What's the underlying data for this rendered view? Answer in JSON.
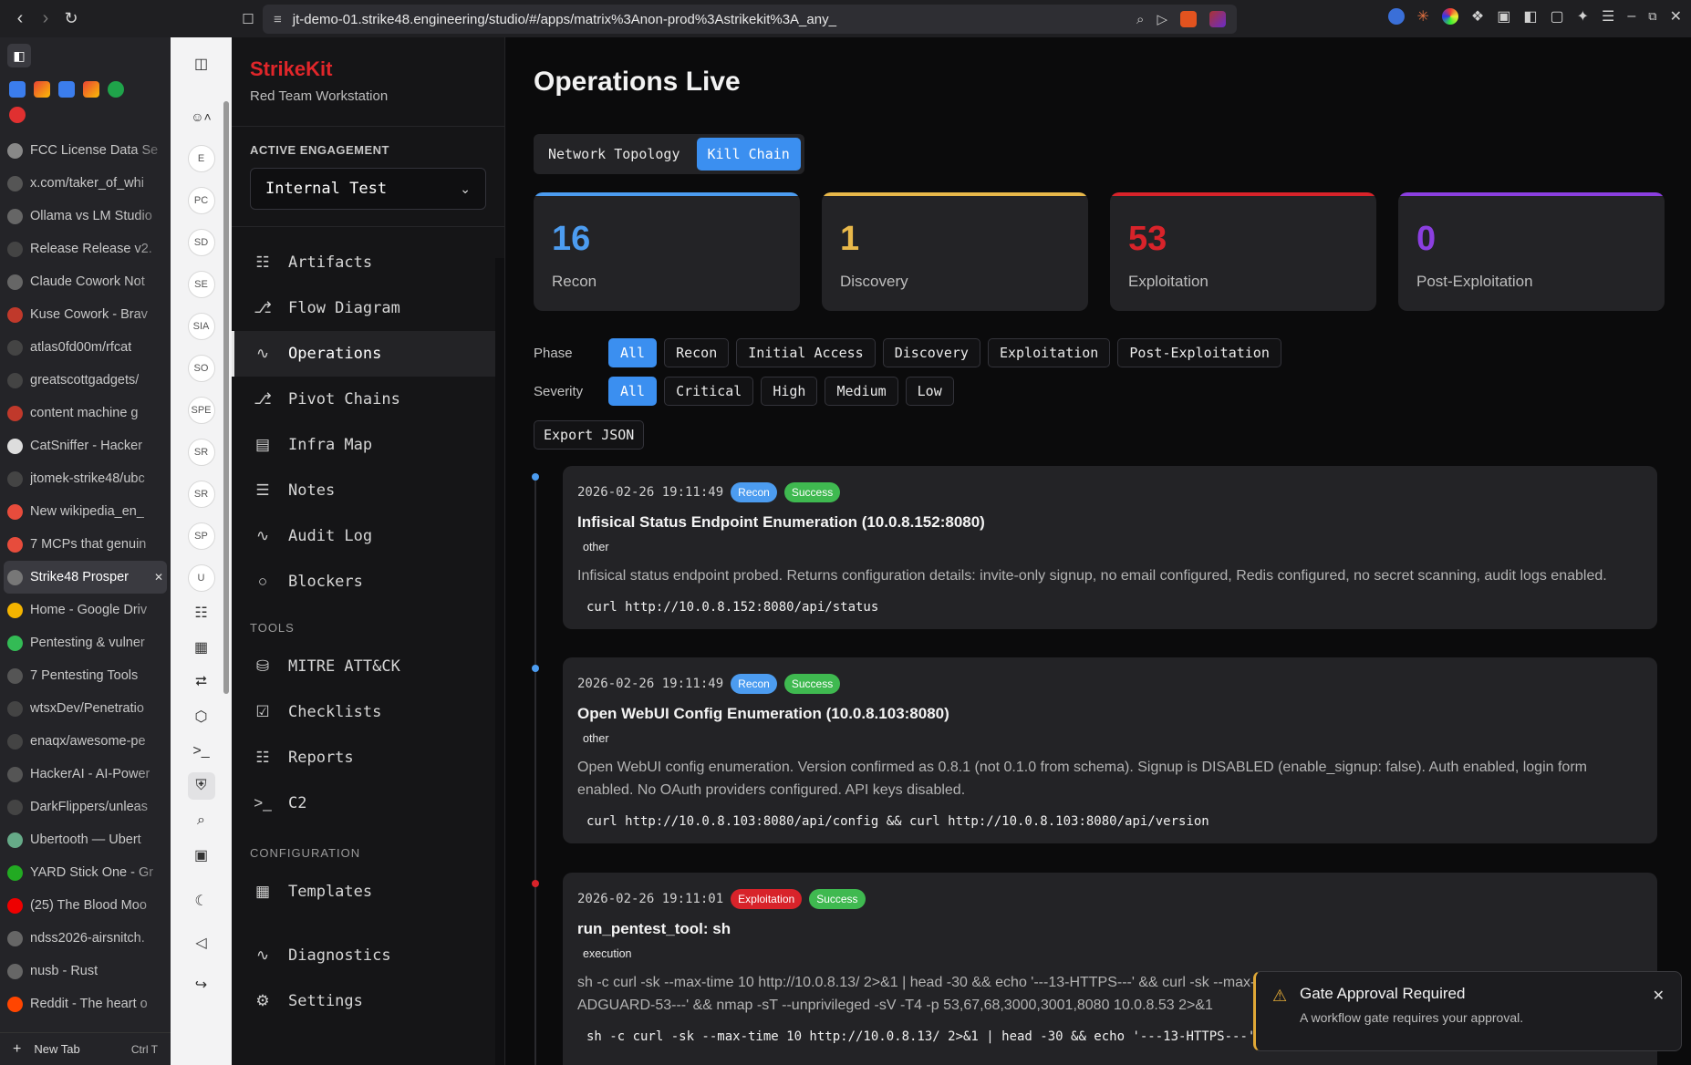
{
  "browser": {
    "url": "jt-demo-01.strike48.engineering/studio/#/apps/matrix%3Anon-prod%3Astrikekit%3A_any_",
    "tabs": [
      {
        "label": "FCC License Data Se",
        "color": "#888"
      },
      {
        "label": "x.com/taker_of_whi",
        "color": "#555"
      },
      {
        "label": "Ollama vs LM Studio",
        "color": "#666"
      },
      {
        "label": "Release Release v2.",
        "color": "#444"
      },
      {
        "label": "Claude Cowork Not",
        "color": "#666"
      },
      {
        "label": "Kuse Cowork - Brav",
        "color": "#c0392b"
      },
      {
        "label": "atlas0fd00m/rfcat",
        "color": "#444"
      },
      {
        "label": "greatscottgadgets/",
        "color": "#444"
      },
      {
        "label": "content machine g",
        "color": "#c0392b"
      },
      {
        "label": "CatSniffer - Hacker",
        "color": "#ddd"
      },
      {
        "label": "jtomek-strike48/ubc",
        "color": "#444"
      },
      {
        "label": "New wikipedia_en_",
        "color": "#e74c3c"
      },
      {
        "label": "7 MCPs that genuin",
        "color": "#e74c3c"
      },
      {
        "label": "Strike48 Prosper",
        "color": "#777",
        "active": true
      },
      {
        "label": "Home - Google Driv",
        "color": "#f4b400"
      },
      {
        "label": "Pentesting & vulner",
        "color": "#3b5"
      },
      {
        "label": "7 Pentesting Tools",
        "color": "#555"
      },
      {
        "label": "wtsxDev/Penetratio",
        "color": "#444"
      },
      {
        "label": "enaqx/awesome-pe",
        "color": "#444"
      },
      {
        "label": "HackerAI - AI-Power",
        "color": "#555"
      },
      {
        "label": "DarkFlippers/unleas",
        "color": "#444"
      },
      {
        "label": "Ubertooth — Ubert",
        "color": "#6a8"
      },
      {
        "label": "YARD Stick One - Gr",
        "color": "#2a2"
      },
      {
        "label": "(25) The Blood Moo",
        "color": "#e00"
      },
      {
        "label": "ndss2026-airsnitch.",
        "color": "#666"
      },
      {
        "label": "nusb - Rust",
        "color": "#666"
      },
      {
        "label": "Reddit - The heart o",
        "color": "#ff4500"
      }
    ],
    "new_tab": "New Tab",
    "new_tab_shortcut": "Ctrl T"
  },
  "rail": {
    "items": [
      "E",
      "PC",
      "SD",
      "SE",
      "SIA",
      "SO",
      "SPE",
      "SR",
      "SR",
      "SP",
      "U"
    ]
  },
  "app": {
    "brand": "StrikeKit",
    "subtitle": "Red Team Workstation",
    "engagement_label": "ACTIVE ENGAGEMENT",
    "engagement_value": "Internal Test",
    "nav": [
      {
        "label": "Artifacts",
        "icon": "file-icon"
      },
      {
        "label": "Flow Diagram",
        "icon": "git-branch-icon"
      },
      {
        "label": "Operations",
        "icon": "activity-icon",
        "active": true
      },
      {
        "label": "Pivot Chains",
        "icon": "git-branch-icon"
      },
      {
        "label": "Infra Map",
        "icon": "map-icon"
      },
      {
        "label": "Notes",
        "icon": "notes-icon"
      },
      {
        "label": "Audit Log",
        "icon": "activity-icon"
      },
      {
        "label": "Blockers",
        "icon": "circle-icon"
      }
    ],
    "tools_label": "TOOLS",
    "tools": [
      {
        "label": "MITRE ATT&CK",
        "icon": "database-icon"
      },
      {
        "label": "Checklists",
        "icon": "checklist-icon"
      },
      {
        "label": "Reports",
        "icon": "file-icon"
      },
      {
        "label": "C2",
        "icon": "terminal-icon"
      }
    ],
    "config_label": "CONFIGURATION",
    "config": [
      {
        "label": "Templates",
        "icon": "grid-icon"
      }
    ],
    "bottom": [
      {
        "label": "Diagnostics",
        "icon": "activity-icon"
      },
      {
        "label": "Settings",
        "icon": "gear-icon"
      }
    ]
  },
  "main": {
    "title": "Operations Live",
    "view_tabs": [
      "Network Topology",
      "Kill Chain"
    ],
    "active_view": "Kill Chain",
    "stats": [
      {
        "value": "16",
        "label": "Recon",
        "color": "#4c9cf0"
      },
      {
        "value": "1",
        "label": "Discovery",
        "color": "#e8b84a"
      },
      {
        "value": "53",
        "label": "Exploitation",
        "color": "#d8232a"
      },
      {
        "value": "0",
        "label": "Post-Exploitation",
        "color": "#8b3fe0"
      }
    ],
    "phase_label": "Phase",
    "phase_options": [
      "All",
      "Recon",
      "Initial Access",
      "Discovery",
      "Exploitation",
      "Post-Exploitation"
    ],
    "severity_label": "Severity",
    "severity_options": [
      "All",
      "Critical",
      "High",
      "Medium",
      "Low"
    ],
    "export_label": "Export JSON",
    "events": [
      {
        "time": "2026-02-26 19:11:49",
        "phase": "Recon",
        "status": "Success",
        "title": "Infisical Status Endpoint Enumeration (10.0.8.152:8080)",
        "tag": "other",
        "description": "Infisical status endpoint probed. Returns configuration details: invite-only signup, no email configured, Redis configured, no secret scanning, audit logs enabled.",
        "command": "curl http://10.0.8.152:8080/api/status"
      },
      {
        "time": "2026-02-26 19:11:49",
        "phase": "Recon",
        "status": "Success",
        "title": "Open WebUI Config Enumeration (10.0.8.103:8080)",
        "tag": "other",
        "description": "Open WebUI config enumeration. Version confirmed as 0.8.1 (not 0.1.0 from schema). Signup is DISABLED (enable_signup: false). Auth enabled, login form enabled. No OAuth providers configured. API keys disabled.",
        "command": "curl http://10.0.8.103:8080/api/config && curl http://10.0.8.103:8080/api/version"
      },
      {
        "time": "2026-02-26 19:11:01",
        "phase": "Exploitation",
        "status": "Success",
        "title": "run_pentest_tool: sh",
        "tag": "execution",
        "description": "sh -c curl -sk --max-time 10 http://10.0.8.13/ 2>&1 | head -30 && echo '---13-HTTPS---' && curl -sk --max-time 10 https://10.0.8.13/ 2>&1 | head -30 && echo '---ADGUARD-53---' && nmap -sT --unprivileged -sV -T4 -p 53,67,68,3000,3001,8080 10.0.8.53 2>&1",
        "command": "sh -c curl -sk --max-time 10 http://10.0.8.13/ 2>&1 | head -30 && echo '---13-HTTPS---' && curl -sk --max-time 10 https://10.0.8.13/ 2>&1 | head -30"
      }
    ]
  },
  "toast": {
    "title": "Gate Approval Required",
    "message": "A workflow gate requires your approval."
  },
  "colors": {
    "accent": "#3b8ff0",
    "recon": "#4c9cf0",
    "exploitation": "#d8232a",
    "success": "#3fb950",
    "warning": "#e0a836",
    "brand": "#e0262a"
  }
}
